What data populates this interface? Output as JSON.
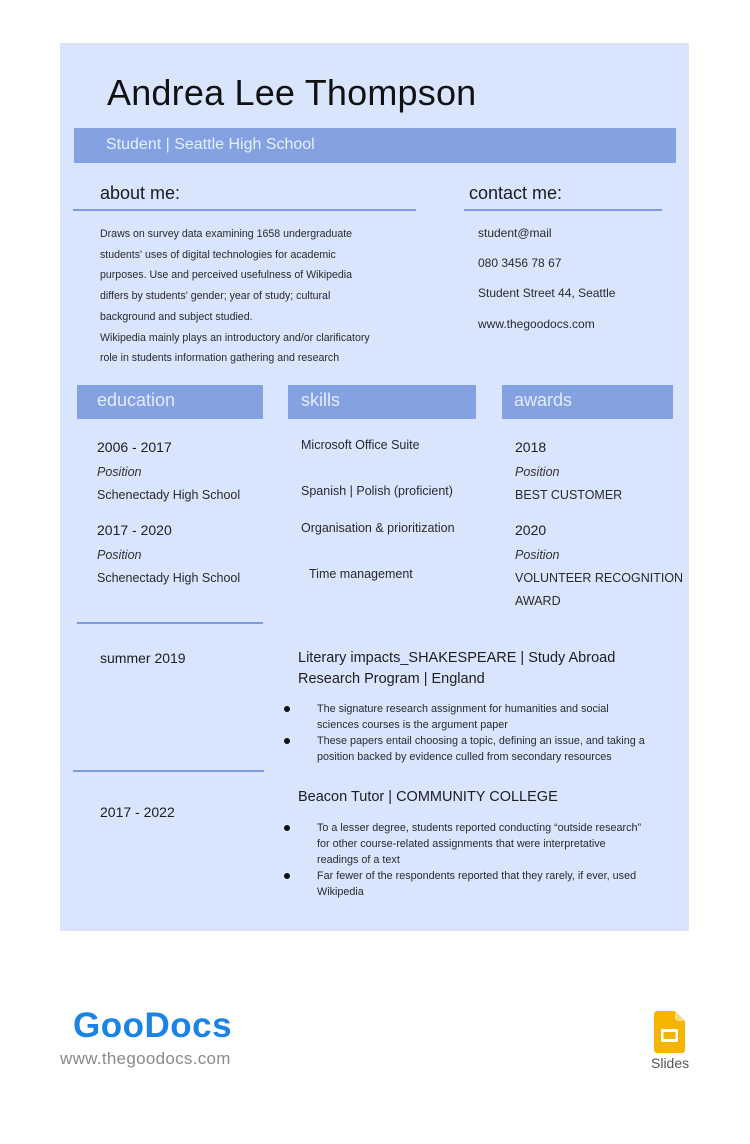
{
  "header": {
    "name": "Andrea Lee Thompson",
    "subtitle": "Student | Seattle High School"
  },
  "about": {
    "heading": "about me:",
    "lines": [
      "Draws on survey data examining 1658 undergraduate",
      "students' uses of digital technologies for academic",
      "purposes. Use and perceived usefulness of Wikipedia",
      "differs by students' gender; year of study; cultural",
      "background and subject studied.",
      "Wikipedia mainly plays an introductory and/or clarificatory",
      "role in students information gathering and research"
    ]
  },
  "contact": {
    "heading": "contact me:",
    "email": "student@mail",
    "phone": "080 3456 78 67",
    "address": "Student Street 44, Seattle",
    "website": "www.thegoodocs.com"
  },
  "education": {
    "heading": "education",
    "entries": [
      {
        "years": "2006 - 2017",
        "position": "Position",
        "school": "Schenectady High School"
      },
      {
        "years": "2017 - 2020",
        "position": "Position",
        "school": "Schenectady High School"
      }
    ]
  },
  "skills": {
    "heading": "skills",
    "items": [
      "Microsoft Office Suite",
      "Spanish | Polish (proficient)",
      "Organisation & prioritization",
      "Time management"
    ]
  },
  "awards": {
    "heading": "awards",
    "entries": [
      {
        "year": "2018",
        "position": "Position",
        "title": "BEST CUSTOMER"
      },
      {
        "year": "2020",
        "position": "Position",
        "title_line1": "VOLUNTEER RECOGNITION",
        "title_line2": "AWARD"
      }
    ]
  },
  "experience": [
    {
      "date": "summer 2019",
      "title": "Literary impacts_SHAKESPEARE | Study Abroad Research Program | England",
      "bullets": [
        "The signature research assignment for humanities and social sciences courses is the argument paper",
        "These papers entail choosing a topic, defining an issue, and taking a position backed by evidence culled from secondary resources"
      ]
    },
    {
      "date": "2017 - 2022",
      "title": "Beacon Tutor | COMMUNITY COLLEGE",
      "bullets": [
        "To a lesser degree, students reported conducting “outside research” for other course-related assignments that were interpretative readings of a text",
        "Far fewer of the respondents reported that they rarely, if ever, used Wikipedia"
      ]
    }
  ],
  "footer": {
    "brand": "GooDocs",
    "url": "www.thegoodocs.com",
    "slides_label": "Slides"
  },
  "colors": {
    "panel_bg": "#d9e4fd",
    "accent_bar": "#84a2e2",
    "brand_blue": "#1a83e6",
    "slides_yellow": "#f4b400"
  }
}
